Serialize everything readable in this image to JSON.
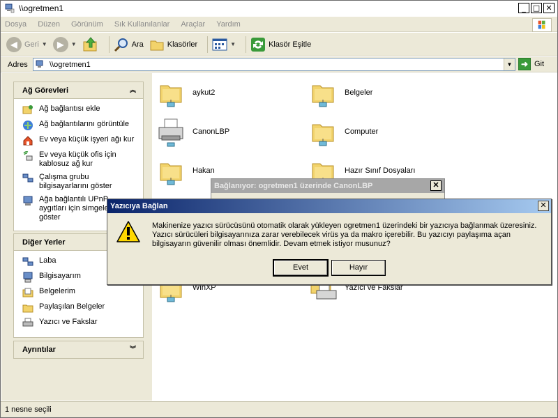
{
  "window": {
    "title": "\\\\ogretmen1",
    "controls": {
      "minimize": "_",
      "maximize": "□",
      "close": "✕"
    }
  },
  "menu": [
    "Dosya",
    "Düzen",
    "Görünüm",
    "Sık Kullanılanlar",
    "Araçlar",
    "Yardım"
  ],
  "toolbar": {
    "back": "Geri",
    "search": "Ara",
    "folders": "Klasörler",
    "sync": "Klasör Eşitle"
  },
  "address": {
    "label": "Adres",
    "value": "\\\\ogretmen1",
    "go": "Git"
  },
  "network_tasks": {
    "title": "Ağ Görevleri",
    "items": [
      "Ağ bağlantısı ekle",
      "Ağ bağlantılarını görüntüle",
      "Ev veya küçük işyeri ağı kur",
      "Ev veya küçük ofis için\nkablosuz ağ kur",
      "Çalışma grubu\nbilgisayarlarını göster",
      "Ağa bağlantılı UPnP\naygıtları için simgeleri\ngöster"
    ]
  },
  "other_places": {
    "title": "Diğer Yerler",
    "items": [
      "Laba",
      "Bilgisayarım",
      "Belgelerim",
      "Paylaşılan Belgeler",
      "Yazıcı ve Fakslar"
    ]
  },
  "details": {
    "title": "Ayrıntılar"
  },
  "items": [
    {
      "name": "aykut2",
      "type": "share"
    },
    {
      "name": "Belgeler",
      "type": "share"
    },
    {
      "name": "CanonLBP",
      "type": "printer"
    },
    {
      "name": "Computer",
      "type": "share"
    },
    {
      "name": "Hakan",
      "type": "share"
    },
    {
      "name": "Hazır Sınıf Dosyaları",
      "type": "share"
    },
    {
      "name": "WinXP",
      "type": "share"
    },
    {
      "name": "Yazıcı ve Fakslar",
      "type": "printer"
    }
  ],
  "status": "1 nesne seçili",
  "connecting_dialog": {
    "title": "Bağlanıyor: ogretmen1 üzerinde CanonLBP"
  },
  "dialog": {
    "title": "Yazıcıya Bağlan",
    "message": "Makinenize yazıcı sürücüsünü otomatik olarak yükleyen ogretmen1 üzerindeki bir yazıcıya bağlanmak üzeresiniz. Yazıcı sürücüleri bilgisayarınıza zarar verebilecek virüs ya da makro içerebilir. Bu yazıcıyı paylaşıma açan bilgisayarın güvenilir olması önemlidir. Devam etmek istiyor musunuz?",
    "yes": "Evet",
    "no": "Hayır"
  }
}
